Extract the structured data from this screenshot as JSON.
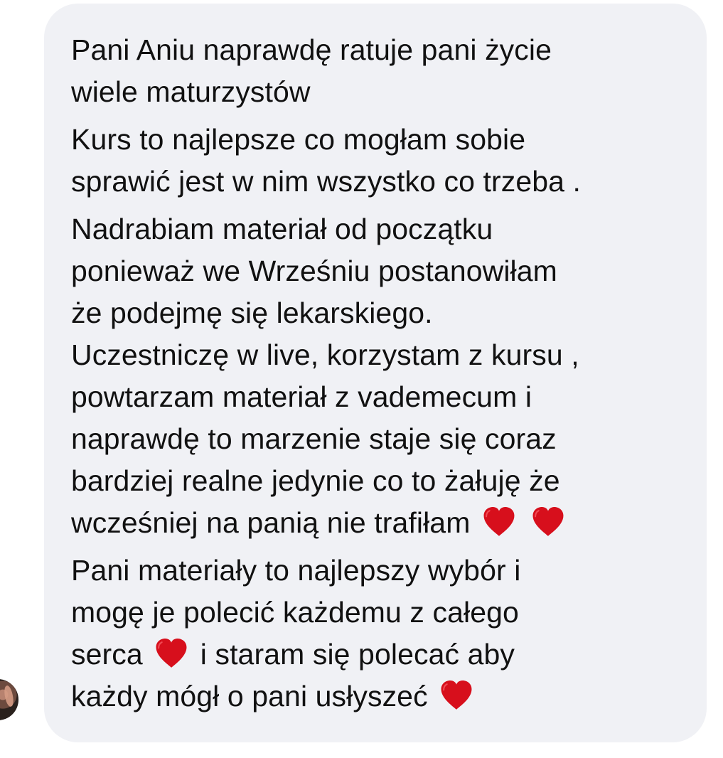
{
  "message": {
    "lines": [
      "Pani Aniu naprawdę ratuje pani życie",
      "wiele maturzystów",
      "Kurs to najlepsze co mogłam sobie",
      "sprawić jest w nim wszystko co trzeba .",
      "Nadrabiam materiał od początku",
      "ponieważ we Wrześniu postanowiłam",
      "że podejmę się lekarskiego.",
      "Uczestniczę w live, korzystam z kursu ,",
      "powtarzam materiał z vademecum i",
      "naprawdę to marzenie staje się coraz",
      "bardziej realne jedynie co to żałuję że",
      "wcześniej na panią nie trafiłam",
      "Pani materiały to najlepszy wybór i",
      "mogę je polecić każdemu z całego",
      "serca",
      "i staram się polecać aby",
      "każdy mógł o pani usłyszeć"
    ]
  },
  "icons": {
    "heart": "red-heart-icon",
    "avatar": "avatar"
  },
  "colors": {
    "bubble_background": "#f0f1f5",
    "text": "#111111",
    "heart": "#d70f1c"
  }
}
